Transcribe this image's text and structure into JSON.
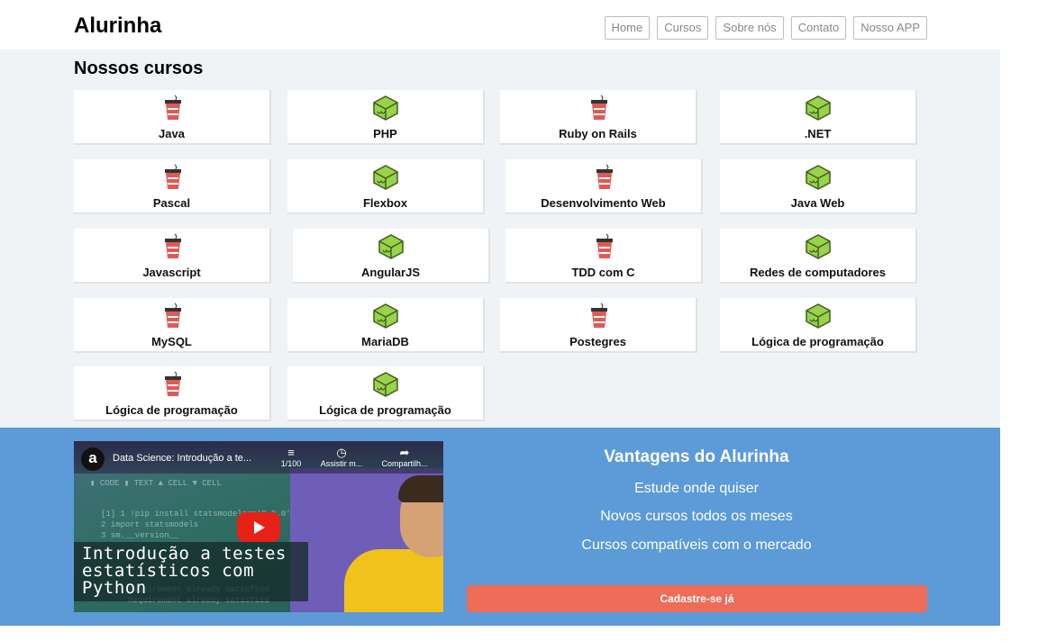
{
  "header": {
    "logo": "Alurinha",
    "nav": [
      "Home",
      "Cursos",
      "Sobre nós",
      "Contato",
      "Nosso APP"
    ]
  },
  "courses": {
    "title": "Nossos cursos",
    "items": [
      {
        "label": "Java",
        "icon": "cup-icon"
      },
      {
        "label": "PHP",
        "icon": "cube-icon"
      },
      {
        "label": "Ruby on Rails",
        "icon": "cup-icon"
      },
      {
        "label": ".NET",
        "icon": "cube-icon"
      },
      {
        "label": "Pascal",
        "icon": "cup-icon"
      },
      {
        "label": "Flexbox",
        "icon": "cube-icon"
      },
      {
        "label": "Desenvolvimento Web",
        "icon": "cup-icon"
      },
      {
        "label": "Java Web",
        "icon": "cube-icon"
      },
      {
        "label": "Javascript",
        "icon": "cup-icon"
      },
      {
        "label": "AngularJS",
        "icon": "cube-icon"
      },
      {
        "label": "TDD com C",
        "icon": "cup-icon"
      },
      {
        "label": "Redes de computadores",
        "icon": "cube-icon"
      },
      {
        "label": "MySQL",
        "icon": "cup-icon"
      },
      {
        "label": "MariaDB",
        "icon": "cube-icon"
      },
      {
        "label": "Postegres",
        "icon": "cup-icon"
      },
      {
        "label": "Lógica de programação",
        "icon": "cube-icon"
      },
      {
        "label": "Lógica de programação",
        "icon": "cup-icon"
      },
      {
        "label": "Lógica de programação",
        "icon": "cube-icon"
      }
    ]
  },
  "video": {
    "channel_initial": "a",
    "title": "Data Science: Introdução a te...",
    "playlist_count": "1/100",
    "watch_later": "Assistir m...",
    "share": "Compartilh...",
    "caption": [
      "Introdução a testes",
      "estatísticos com",
      "Python"
    ]
  },
  "advantages": {
    "title": "Vantagens do Alurinha",
    "items": [
      "Estude onde quiser",
      "Novos cursos todos os meses",
      "Cursos compatíveis com o mercado"
    ],
    "cta": "Cadastre-se já"
  },
  "colors": {
    "banner": "#5c9ad8",
    "cta": "#ee6c58",
    "cup_red": "#e05a55",
    "cube_green": "#9ad24a"
  }
}
